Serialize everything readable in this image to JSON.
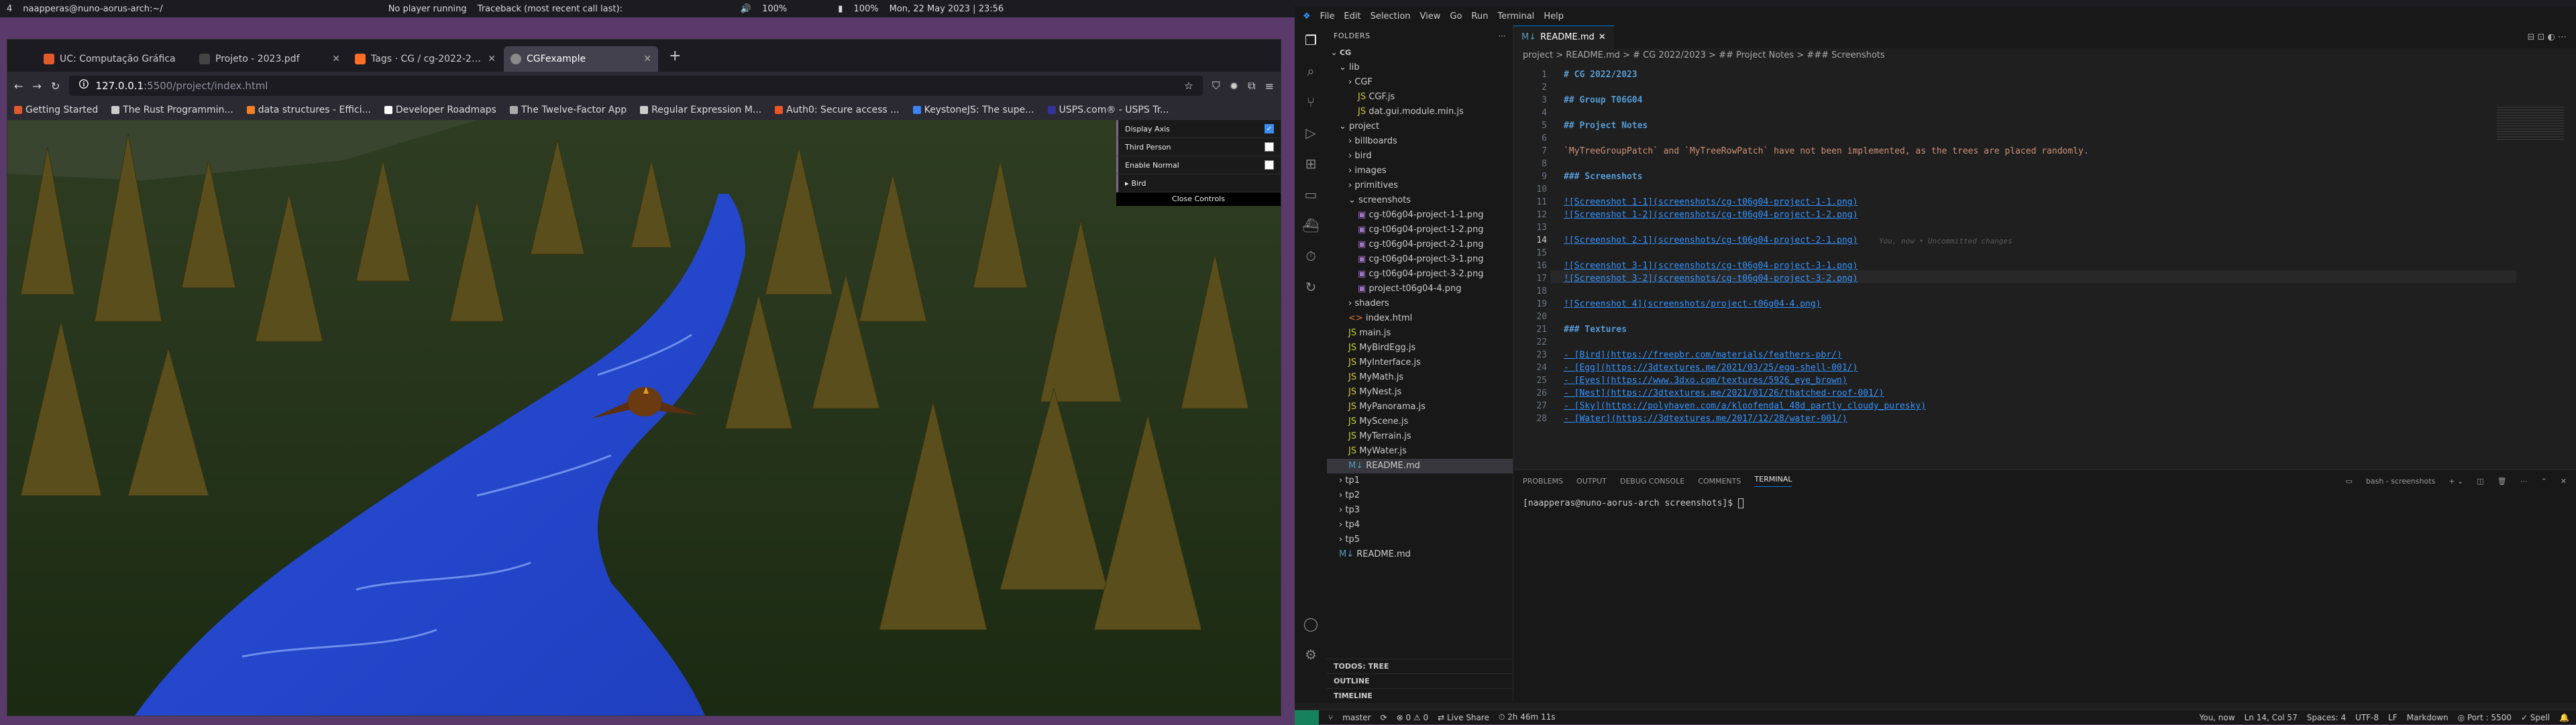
{
  "panel": {
    "workspace": "4",
    "terminal_title": "naapperas@nuno-aorus-arch:~/",
    "media": "No player running",
    "notification": "Traceback (most recent call last):",
    "volume": "100%",
    "battery": "100%",
    "datetime": "Mon, 22 May 2023 | 23:56"
  },
  "firefox": {
    "tabs": [
      {
        "label": "UC: Computação Gráfica",
        "color": "#e05a2c"
      },
      {
        "label": "Projeto - 2023.pdf",
        "color": "#444444"
      },
      {
        "label": "Tags · CG / cg-2022-2023",
        "color": "#fc6d26"
      },
      {
        "label": "CGFexample",
        "color": "#8a8a8a"
      }
    ],
    "url_host": "127.0.0.1",
    "url_rest": ":5500/project/index.html",
    "bookmarks": [
      {
        "label": "Getting Started",
        "color": "#e05a2c"
      },
      {
        "label": "The Rust Programmin...",
        "color": "#cccccc"
      },
      {
        "label": "data structures - Effici...",
        "color": "#f48024"
      },
      {
        "label": "Developer Roadmaps",
        "color": "#ffffff"
      },
      {
        "label": "The Twelve-Factor App",
        "color": "#aaaaaa"
      },
      {
        "label": "Regular Expression M...",
        "color": "#cccccc"
      },
      {
        "label": "Auth0: Secure access ...",
        "color": "#eb5424"
      },
      {
        "label": "KeystoneJS: The supe...",
        "color": "#3b82f6"
      },
      {
        "label": "USPS.com® - USPS Tr...",
        "color": "#333399"
      }
    ],
    "gui": {
      "display_axis": "Display Axis",
      "third_person": "Third Person",
      "enable_normal": "Enable Normal",
      "bird": "Bird",
      "close": "Close Controls"
    }
  },
  "vscode": {
    "menu": [
      "File",
      "Edit",
      "Selection",
      "View",
      "Go",
      "Run",
      "Terminal",
      "Help"
    ],
    "explorer_title": "FOLDERS",
    "root": "CG",
    "tree": [
      {
        "label": "lib",
        "indent": 1,
        "kind": "folder"
      },
      {
        "label": "CGF",
        "indent": 2,
        "kind": "folder"
      },
      {
        "label": "CGF.js",
        "indent": 2,
        "kind": "js"
      },
      {
        "label": "dat.gui.module.min.js",
        "indent": 2,
        "kind": "js"
      },
      {
        "label": "project",
        "indent": 1,
        "kind": "folder"
      },
      {
        "label": "billboards",
        "indent": 2,
        "kind": "folder"
      },
      {
        "label": "bird",
        "indent": 2,
        "kind": "folder"
      },
      {
        "label": "images",
        "indent": 2,
        "kind": "folder"
      },
      {
        "label": "primitives",
        "indent": 2,
        "kind": "folder"
      },
      {
        "label": "screenshots",
        "indent": 2,
        "kind": "folder"
      },
      {
        "label": "cg-t06g04-project-1-1.png",
        "indent": 3,
        "kind": "img"
      },
      {
        "label": "cg-t06g04-project-1-2.png",
        "indent": 3,
        "kind": "img"
      },
      {
        "label": "cg-t06g04-project-2-1.png",
        "indent": 3,
        "kind": "img"
      },
      {
        "label": "cg-t06g04-project-3-1.png",
        "indent": 3,
        "kind": "img"
      },
      {
        "label": "cg-t06g04-project-3-2.png",
        "indent": 3,
        "kind": "img"
      },
      {
        "label": "project-t06g04-4.png",
        "indent": 3,
        "kind": "img"
      },
      {
        "label": "shaders",
        "indent": 2,
        "kind": "folder"
      },
      {
        "label": "index.html",
        "indent": 2,
        "kind": "html"
      },
      {
        "label": "main.js",
        "indent": 2,
        "kind": "js"
      },
      {
        "label": "MyBirdEgg.js",
        "indent": 2,
        "kind": "js"
      },
      {
        "label": "MyInterface.js",
        "indent": 2,
        "kind": "js"
      },
      {
        "label": "MyMath.js",
        "indent": 2,
        "kind": "js"
      },
      {
        "label": "MyNest.js",
        "indent": 2,
        "kind": "js"
      },
      {
        "label": "MyPanorama.js",
        "indent": 2,
        "kind": "js"
      },
      {
        "label": "MyScene.js",
        "indent": 2,
        "kind": "js"
      },
      {
        "label": "MyTerrain.js",
        "indent": 2,
        "kind": "js"
      },
      {
        "label": "MyWater.js",
        "indent": 2,
        "kind": "js"
      },
      {
        "label": "README.md",
        "indent": 2,
        "kind": "md",
        "selected": true
      },
      {
        "label": "tp1",
        "indent": 1,
        "kind": "folder"
      },
      {
        "label": "tp2",
        "indent": 1,
        "kind": "folder"
      },
      {
        "label": "tp3",
        "indent": 1,
        "kind": "folder"
      },
      {
        "label": "tp4",
        "indent": 1,
        "kind": "folder"
      },
      {
        "label": "tp5",
        "indent": 1,
        "kind": "folder"
      },
      {
        "label": "README.md",
        "indent": 1,
        "kind": "md"
      }
    ],
    "outline": [
      "TODOS: TREE",
      "OUTLINE",
      "TIMELINE"
    ],
    "editor_tab": "README.md",
    "breadcrumb": "project > README.md > # CG 2022/2023 > ## Project Notes > ### Screenshots",
    "lines": [
      {
        "n": "1",
        "t": "# CG 2022/2023",
        "c": "h"
      },
      {
        "n": "2",
        "t": "",
        "c": ""
      },
      {
        "n": "3",
        "t": "## Group T06G04",
        "c": "h"
      },
      {
        "n": "4",
        "t": "",
        "c": ""
      },
      {
        "n": "5",
        "t": "## Project Notes",
        "c": "h"
      },
      {
        "n": "6",
        "t": "",
        "c": ""
      },
      {
        "n": "7",
        "t": "`MyTreeGroupPatch` and `MyTreeRowPatch` have not been implemented, as the trees are placed randomly.",
        "c": "lk"
      },
      {
        "n": "8",
        "t": "",
        "c": ""
      },
      {
        "n": "9",
        "t": "### Screenshots",
        "c": "h"
      },
      {
        "n": "10",
        "t": "",
        "c": ""
      },
      {
        "n": "11",
        "t": "![Screenshot 1-1](screenshots/cg-t06g04-project-1-1.png)",
        "c": "u"
      },
      {
        "n": "12",
        "t": "![Screenshot 1-2](screenshots/cg-t06g04-project-1-2.png)",
        "c": "u"
      },
      {
        "n": "13",
        "t": "",
        "c": ""
      },
      {
        "n": "14",
        "t": "![Screenshot 2-1](screenshots/cg-t06g04-project-2-1.png)",
        "c": "u"
      },
      {
        "n": "15",
        "t": "",
        "c": ""
      },
      {
        "n": "16",
        "t": "![Screenshot 3-1](screenshots/cg-t06g04-project-3-1.png)",
        "c": "u"
      },
      {
        "n": "17",
        "t": "![Screenshot 3-2](screenshots/cg-t06g04-project-3-2.png)",
        "c": "u"
      },
      {
        "n": "18",
        "t": "",
        "c": ""
      },
      {
        "n": "19",
        "t": "![Screenshot 4](screenshots/project-t06g04-4.png)",
        "c": "u"
      },
      {
        "n": "20",
        "t": "",
        "c": ""
      },
      {
        "n": "21",
        "t": "### Textures",
        "c": "h"
      },
      {
        "n": "22",
        "t": "",
        "c": ""
      },
      {
        "n": "23",
        "t": "- [Bird](https://freepbr.com/materials/feathers-pbr/)",
        "c": "u"
      },
      {
        "n": "24",
        "t": "- [Egg](https://3dtextures.me/2021/03/25/egg-shell-001/)",
        "c": "u"
      },
      {
        "n": "25",
        "t": "- [Eyes](https://www.3dxo.com/textures/5926_eye_brown)",
        "c": "u"
      },
      {
        "n": "26",
        "t": "- [Nest](https://3dtextures.me/2021/01/26/thatched-roof-001/)",
        "c": "u"
      },
      {
        "n": "27",
        "t": "- [Sky](https://polyhaven.com/a/kloofendal_48d_partly_cloudy_puresky)",
        "c": "u"
      },
      {
        "n": "28",
        "t": "- [Water](https://3dtextures.me/2017/12/28/water-001/)",
        "c": "u"
      }
    ],
    "blame_14": "You, now • Uncommitted changes",
    "panel_tabs": [
      "PROBLEMS",
      "OUTPUT",
      "DEBUG CONSOLE",
      "COMMENTS",
      "TERMINAL"
    ],
    "terminal_name": "bash - screenshots",
    "prompt": "[naapperas@nuno-aorus-arch screenshots]$ ",
    "status": {
      "branch": "master",
      "errors": "0 ⚠ 0",
      "live_share": "Live Share",
      "time": "2h 46m 11s",
      "blame": "You, now",
      "cursor": "Ln 14, Col 57",
      "spaces": "Spaces: 4",
      "encoding": "UTF-8",
      "eol": "LF",
      "lang": "Markdown",
      "port": "Port : 5500",
      "spell": "Spell"
    }
  }
}
